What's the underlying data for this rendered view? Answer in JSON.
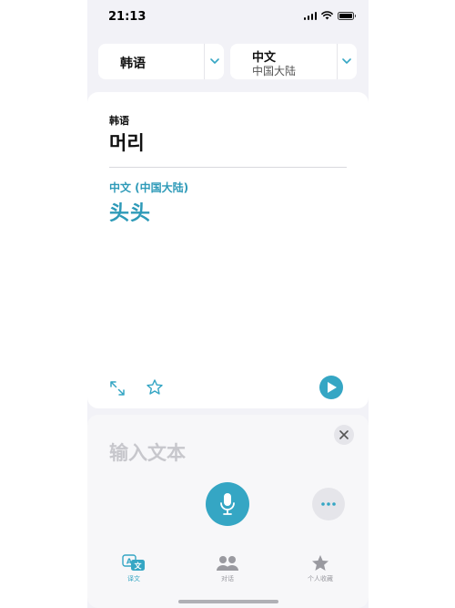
{
  "status_bar": {
    "time": "21:13"
  },
  "language_bar": {
    "source": {
      "label": "韩语"
    },
    "target": {
      "label": "中文",
      "sublabel": "中国大陆"
    }
  },
  "translation": {
    "source_lang": "韩语",
    "source_text": "머리",
    "target_lang": "中文 (中国大陆)",
    "target_text": "头头"
  },
  "input": {
    "placeholder": "输入文本"
  },
  "tabs": [
    {
      "label": "译文",
      "active": true
    },
    {
      "label": "对话",
      "active": false
    },
    {
      "label": "个人收藏",
      "active": false
    }
  ],
  "colors": {
    "accent": "#35a6c4",
    "accent_text": "#2e9ab8",
    "background": "#f2f2f7"
  },
  "icons": [
    "signal-icon",
    "wifi-icon",
    "battery-icon",
    "chevron-down-icon",
    "expand-icon",
    "star-icon",
    "play-icon",
    "close-icon",
    "microphone-icon",
    "more-icon",
    "translate-icon",
    "conversation-icon",
    "favorites-star-icon"
  ]
}
